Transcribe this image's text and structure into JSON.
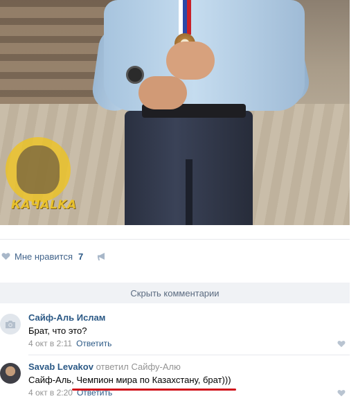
{
  "post": {
    "watermark": "КАЧALKA",
    "likes": {
      "label": "Мне нравится",
      "count": "7"
    }
  },
  "hide_comments_label": "Скрыть комментарии",
  "comments": [
    {
      "author": "Сайф-Аль Ислам",
      "replied_word": "",
      "reply_to": "",
      "text": "Брат, что это?",
      "date": "4 окт в 2:11",
      "reply_label": "Ответить"
    },
    {
      "author": "Savab Levakov",
      "replied_word": "ответил",
      "reply_to": "Сайфу-Алю",
      "text_prefix": "Сайф-Аль, ",
      "text_highlight": "Чемпион мира по Казахстану, брат)))",
      "date": "4 окт в 2:20",
      "reply_label": "Ответить"
    }
  ],
  "colors": {
    "link": "#2a5885",
    "muted": "#939393",
    "underline": "#d0101a",
    "bar": "#f0f2f5"
  }
}
